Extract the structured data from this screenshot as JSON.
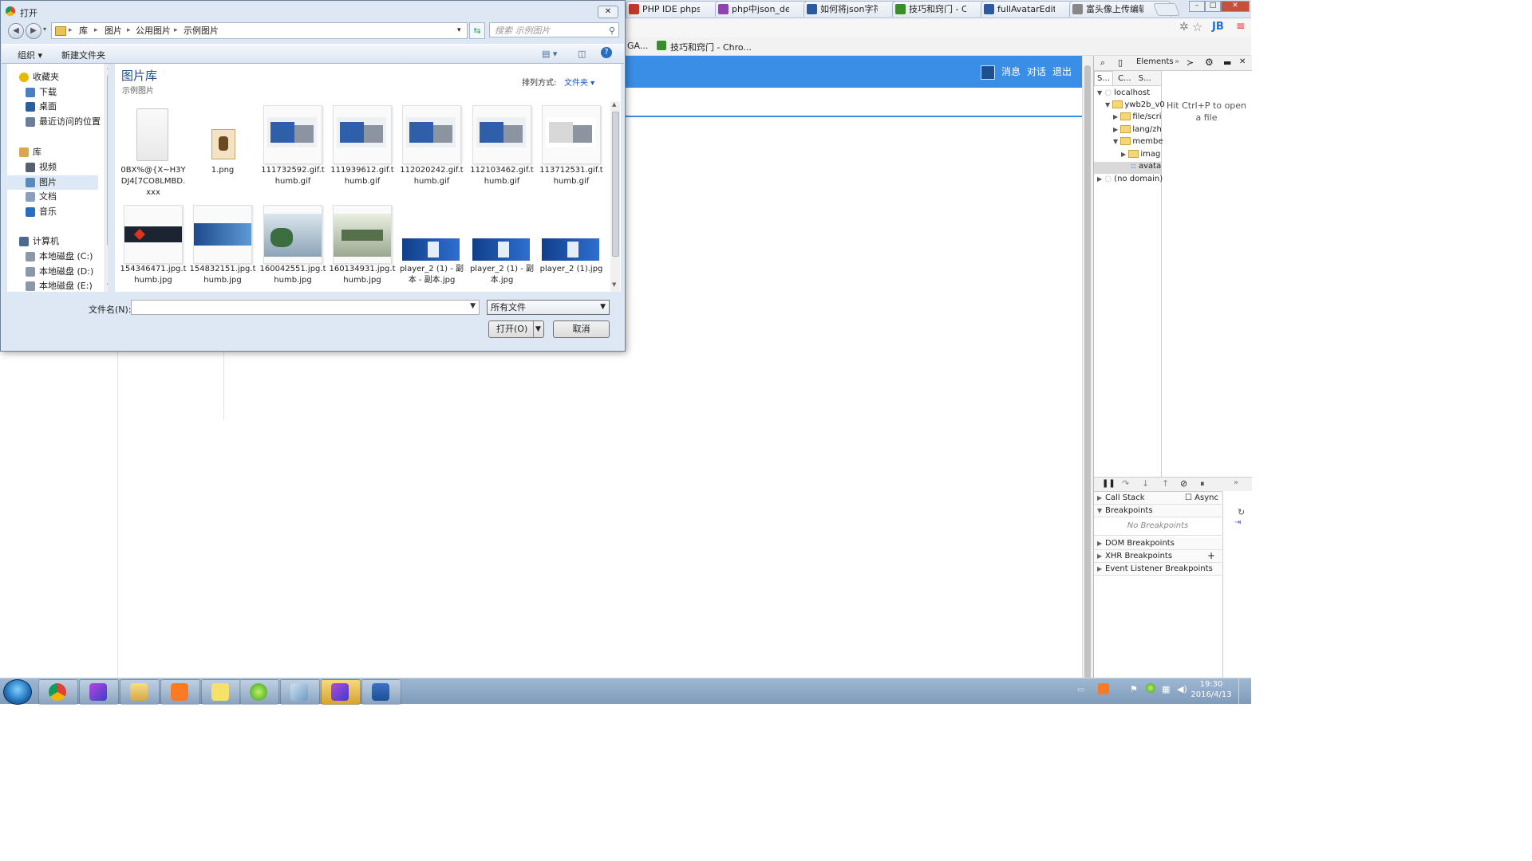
{
  "browser": {
    "tabs": [
      {
        "label": "PHP IDE phpst",
        "color": "#c0392b"
      },
      {
        "label": "php中json_dec",
        "color": "#8e44ad"
      },
      {
        "label": "如何将json字符",
        "color": "#2c5aa0"
      },
      {
        "label": "技巧和窍门 - C",
        "color": "#3a8e2a"
      },
      {
        "label": "fullAvatarEdito",
        "color": "#2c5aa0"
      },
      {
        "label": "富头像上传编辑",
        "color": "#888888"
      }
    ],
    "bookmarks": [
      "GA...",
      "技巧和窍门 - Chro..."
    ]
  },
  "page": {
    "nav": [
      "消息",
      "对话",
      "退出"
    ],
    "header_color": "#3a8ee6"
  },
  "devtools": {
    "tab": "Elements",
    "subtabs": [
      "S...",
      "C...",
      "S..."
    ],
    "tree": [
      {
        "label": "localhost",
        "kind": "host"
      },
      {
        "label": "ywb2b_v0",
        "kind": "folder"
      },
      {
        "label": "file/scri",
        "kind": "folder"
      },
      {
        "label": "lang/zh",
        "kind": "folder"
      },
      {
        "label": "membe",
        "kind": "folder"
      },
      {
        "label": "imag",
        "kind": "folder"
      },
      {
        "label": "avata",
        "kind": "file"
      },
      {
        "label": "(no domain)",
        "kind": "host"
      }
    ],
    "hint": "Hit Ctrl+P to open a file",
    "panes": {
      "call_stack": "Call Stack",
      "async": "Async",
      "breakpoints": "Breakpoints",
      "no_breakpoints": "No Breakpoints",
      "dom_breakpoints": "DOM Breakpoints",
      "xhr_breakpoints": "XHR Breakpoints",
      "event_breakpoints": "Event Listener Breakpoints"
    }
  },
  "dialog": {
    "title": "打开",
    "close": "✕",
    "breadcrumb": [
      "库",
      "图片",
      "公用图片",
      "示例图片"
    ],
    "search_placeholder": "搜索 示例图片",
    "commands": {
      "organize": "组织 ▾",
      "new_folder": "新建文件夹"
    },
    "sidebar": [
      {
        "label": "收藏夹",
        "icon": "star-icon",
        "color": "#e6b800"
      },
      {
        "label": "下载",
        "icon": "download-folder-icon",
        "color": "#4a7fc1"
      },
      {
        "label": "桌面",
        "icon": "desktop-icon",
        "color": "#2a5fa0"
      },
      {
        "label": "最近访问的位置",
        "icon": "recent-places-icon",
        "color": "#6a7f99"
      },
      {
        "label": "库",
        "icon": "library-icon",
        "color": "#d9a84a"
      },
      {
        "label": "视频",
        "icon": "videos-icon",
        "color": "#556070"
      },
      {
        "label": "图片",
        "icon": "pictures-icon",
        "color": "#5a8ab8"
      },
      {
        "label": "文档",
        "icon": "documents-icon",
        "color": "#8aa0bb"
      },
      {
        "label": "音乐",
        "icon": "music-icon",
        "color": "#2b6cc0"
      },
      {
        "label": "计算机",
        "icon": "computer-icon",
        "color": "#4a6a90"
      },
      {
        "label": "本地磁盘 (C:)",
        "icon": "drive-icon",
        "color": "#8a98a8"
      },
      {
        "label": "本地磁盘 (D:)",
        "icon": "drive-icon",
        "color": "#8a98a8"
      },
      {
        "label": "本地磁盘 (E:)",
        "icon": "drive-icon",
        "color": "#8a98a8"
      }
    ],
    "library_title": "图片库",
    "library_sub": "示例图片",
    "sort_label": "排列方式:",
    "sort_value": "文件夹 ▾",
    "files": [
      {
        "name": "0BX%@{X~H3YDJ4[7CO8LMBD.xxx",
        "kind": "blank"
      },
      {
        "name": "1.png",
        "kind": "png"
      },
      {
        "name": "111732592.gif.thumb.gif",
        "kind": "machine"
      },
      {
        "name": "111939612.gif.thumb.gif",
        "kind": "machine"
      },
      {
        "name": "112020242.gif.thumb.gif",
        "kind": "machine"
      },
      {
        "name": "112103462.gif.thumb.gif",
        "kind": "machine"
      },
      {
        "name": "113712531.gif.thumb.gif",
        "kind": "machine-white"
      },
      {
        "name": "154346471.jpg.thumb.jpg",
        "kind": "banner-dark"
      },
      {
        "name": "154832151.jpg.thumb.jpg",
        "kind": "banner-blue"
      },
      {
        "name": "160042551.jpg.thumb.jpg",
        "kind": "photo"
      },
      {
        "name": "160134931.jpg.thumb.jpg",
        "kind": "photo2"
      },
      {
        "name": "player_2 (1) - 副本 - 副本.jpg",
        "kind": "player"
      },
      {
        "name": "player_2 (1) - 副本.jpg",
        "kind": "player"
      },
      {
        "name": "player_2 (1).jpg",
        "kind": "player"
      }
    ],
    "filename_label": "文件名(N):",
    "filename_value": "",
    "filetype": "所有文件",
    "open_label": "打开(O)",
    "cancel_label": "取消"
  },
  "taskbar": {
    "time": "19:30",
    "date": "2016/4/13"
  }
}
